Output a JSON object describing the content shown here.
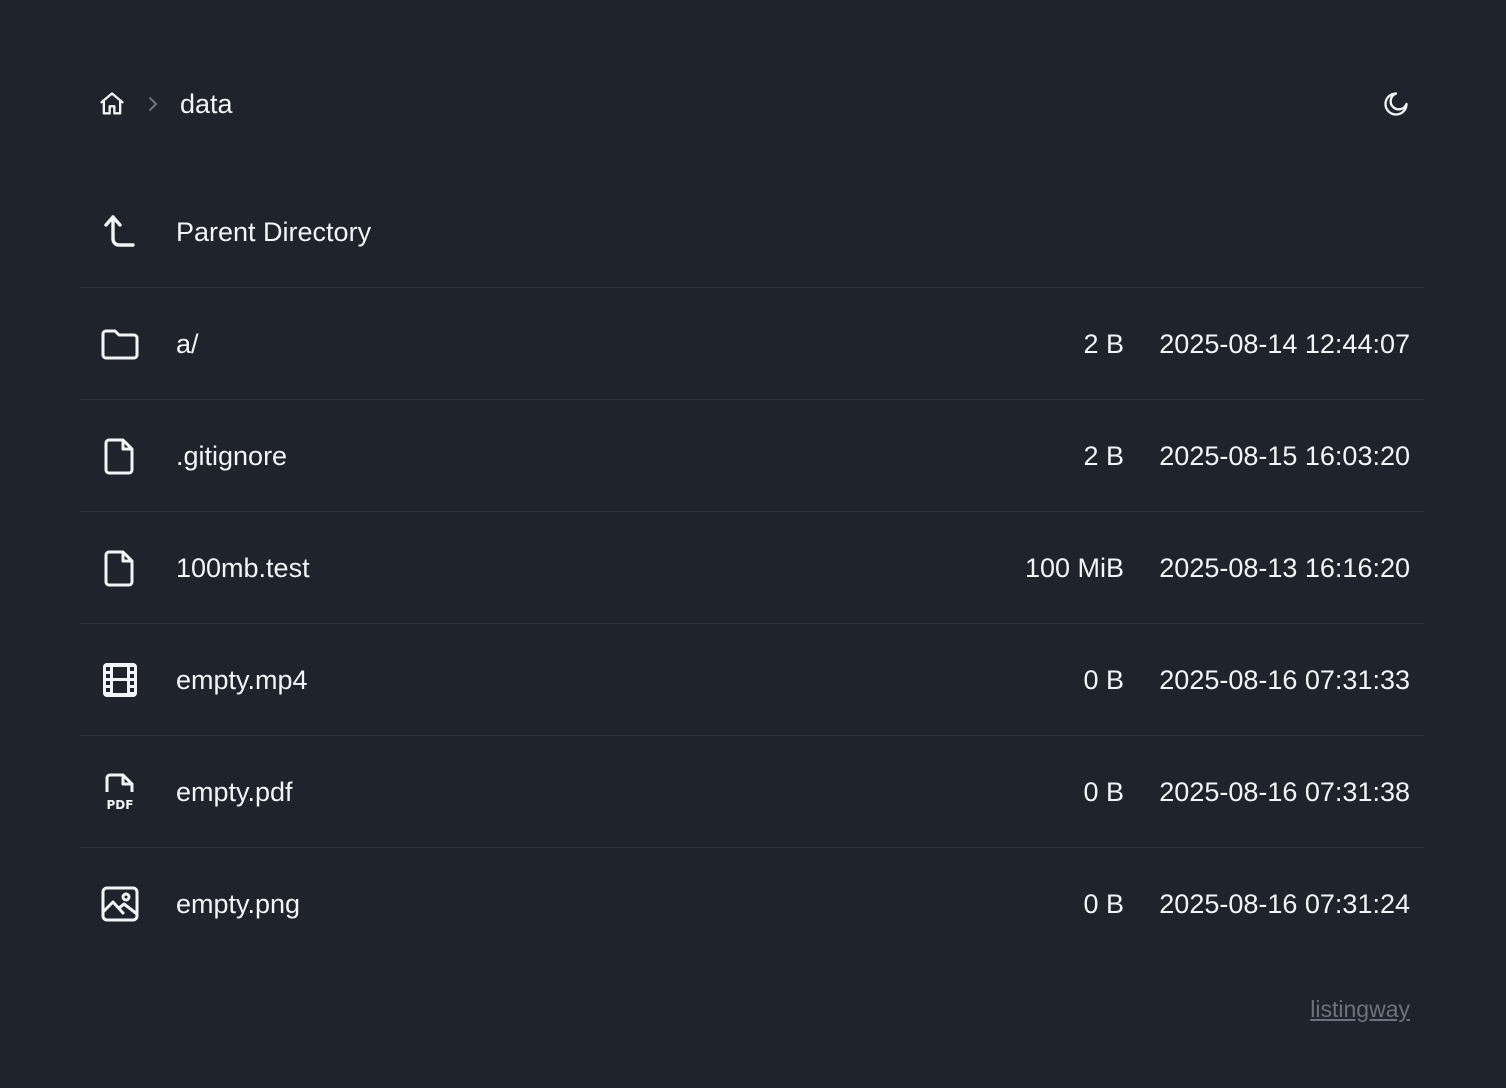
{
  "breadcrumb": {
    "home_icon": "home-icon",
    "separator_icon": "chevron-right-icon",
    "current": "data"
  },
  "theme_toggle": {
    "icon": "moon-icon"
  },
  "parent": {
    "label": "Parent Directory",
    "icon": "corner-left-up-icon"
  },
  "entries": [
    {
      "name": "a/",
      "size": "2 B",
      "modified": "2025-08-14 12:44:07",
      "icon": "folder-icon"
    },
    {
      "name": ".gitignore",
      "size": "2 B",
      "modified": "2025-08-15 16:03:20",
      "icon": "file-icon"
    },
    {
      "name": "100mb.test",
      "size": "100 MiB",
      "modified": "2025-08-13 16:16:20",
      "icon": "file-icon"
    },
    {
      "name": "empty.mp4",
      "size": "0 B",
      "modified": "2025-08-16 07:31:33",
      "icon": "film-icon"
    },
    {
      "name": "empty.pdf",
      "size": "0 B",
      "modified": "2025-08-16 07:31:38",
      "icon": "pdf-file-icon"
    },
    {
      "name": "empty.png",
      "size": "0 B",
      "modified": "2025-08-16 07:31:24",
      "icon": "image-icon"
    }
  ],
  "footer": {
    "link": "listingway"
  },
  "colors": {
    "background": "#1f232b",
    "text": "#f3f4f6",
    "muted": "#6b7280",
    "divider": "#2c313b"
  }
}
